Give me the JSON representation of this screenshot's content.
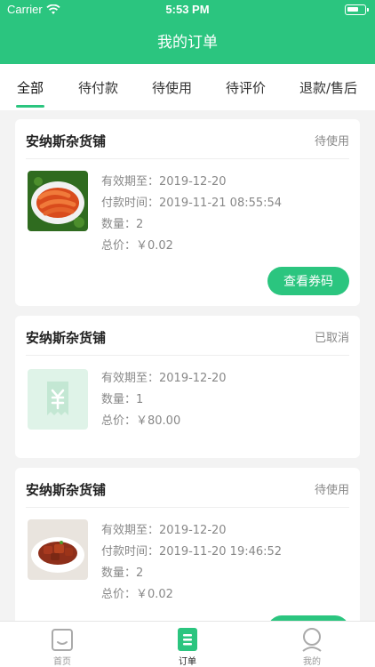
{
  "status_bar": {
    "carrier": "Carrier",
    "time": "5:53 PM"
  },
  "nav": {
    "title": "我的订单"
  },
  "tabs": [
    {
      "label": "全部",
      "active": true
    },
    {
      "label": "待付款",
      "active": false
    },
    {
      "label": "待使用",
      "active": false
    },
    {
      "label": "待评价",
      "active": false
    },
    {
      "label": "退款/售后",
      "active": false
    }
  ],
  "orders": [
    {
      "shop": "安纳斯杂货铺",
      "status": "待使用",
      "valid_until": "有效期至：2019-12-20",
      "paid_time": "付款时间：2019-11-21 08:55:54",
      "quantity": "数量：2",
      "total": "总价：￥0.02",
      "action": "查看券码"
    },
    {
      "shop": "安纳斯杂货铺",
      "status": "已取消",
      "valid_until": "有效期至：2019-12-20",
      "quantity": "数量：1",
      "total": "总价：￥80.00"
    },
    {
      "shop": "安纳斯杂货铺",
      "status": "待使用",
      "valid_until": "有效期至：2019-12-20",
      "paid_time": "付款时间：2019-11-20 19:46:52",
      "quantity": "数量：2",
      "total": "总价：￥0.02"
    }
  ],
  "tabbar": [
    {
      "label": "首页",
      "icon": "home-bag-icon",
      "active": false
    },
    {
      "label": "订单",
      "icon": "order-list-icon",
      "active": true
    },
    {
      "label": "我的",
      "icon": "profile-icon",
      "active": false
    }
  ],
  "colors": {
    "brand": "#2bc57f",
    "background": "#f3f3f3",
    "muted_text": "#888888"
  }
}
